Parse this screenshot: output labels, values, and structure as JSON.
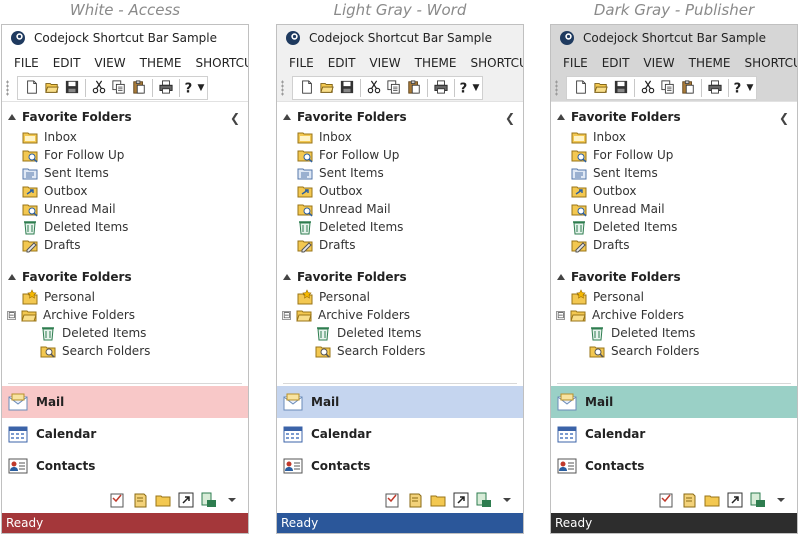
{
  "panels": [
    {
      "caption": "White - Access",
      "title": "Codejock Shortcut Bar Sample",
      "frame_color": "#ffffff",
      "status_color": "#a4373a",
      "selected_color": "#f8c8c8",
      "menu": [
        "FILE",
        "EDIT",
        "VIEW",
        "THEME",
        "SHORTCU"
      ],
      "section1": {
        "header": "Favorite Folders",
        "items": [
          "Inbox",
          "For Follow Up",
          "Sent Items",
          "Outbox",
          "Unread Mail",
          "Deleted Items",
          "Drafts"
        ]
      },
      "section2": {
        "header": "Favorite Folders",
        "personal": "Personal",
        "archive": "Archive Folders",
        "sub": [
          "Deleted Items",
          "Search Folders"
        ],
        "expander": "⊟"
      },
      "nav": {
        "mail": "Mail",
        "calendar": "Calendar",
        "contacts": "Contacts"
      },
      "status": "Ready"
    },
    {
      "caption": "Light Gray - Word",
      "title": "Codejock Shortcut Bar Sample",
      "frame_color": "#f0f0f0",
      "status_color": "#2b579a",
      "selected_color": "#c5d5ef",
      "menu": [
        "FILE",
        "EDIT",
        "VIEW",
        "THEME",
        "SHORTCU"
      ],
      "section1": {
        "header": "Favorite Folders",
        "items": [
          "Inbox",
          "For Follow Up",
          "Sent Items",
          "Outbox",
          "Unread Mail",
          "Deleted Items",
          "Drafts"
        ]
      },
      "section2": {
        "header": "Favorite Folders",
        "personal": "Personal",
        "archive": "Archive Folders",
        "sub": [
          "Deleted Items",
          "Search Folders"
        ],
        "expander": "⊟"
      },
      "nav": {
        "mail": "Mail",
        "calendar": "Calendar",
        "contacts": "Contacts"
      },
      "status": "Ready"
    },
    {
      "caption": "Dark Gray - Publisher",
      "title": "Codejock Shortcut Bar Sample",
      "frame_color": "#d6d6d6",
      "status_color": "#2d2d2d",
      "selected_color": "#9ad0c6",
      "menu": [
        "FILE",
        "EDIT",
        "VIEW",
        "THEME",
        "SHORTCU"
      ],
      "section1": {
        "header": "Favorite Folders",
        "items": [
          "Inbox",
          "For Follow Up",
          "Sent Items",
          "Outbox",
          "Unread Mail",
          "Deleted Items",
          "Drafts"
        ]
      },
      "section2": {
        "header": "Favorite Folders",
        "personal": "Personal",
        "archive": "Archive Folders",
        "sub": [
          "Deleted Items",
          "Search Folders"
        ],
        "expander": "⊟"
      },
      "nav": {
        "mail": "Mail",
        "calendar": "Calendar",
        "contacts": "Contacts"
      },
      "status": "Ready"
    }
  ],
  "icons": {
    "toolbar": [
      "new-document-icon",
      "open-folder-icon",
      "save-icon",
      "cut-icon",
      "copy-icon",
      "paste-icon",
      "print-icon",
      "help-icon"
    ],
    "bottom": [
      "notes-icon",
      "journal-icon",
      "folder-icon",
      "shortcut-icon",
      "folder-list-icon",
      "dropdown-icon"
    ]
  }
}
